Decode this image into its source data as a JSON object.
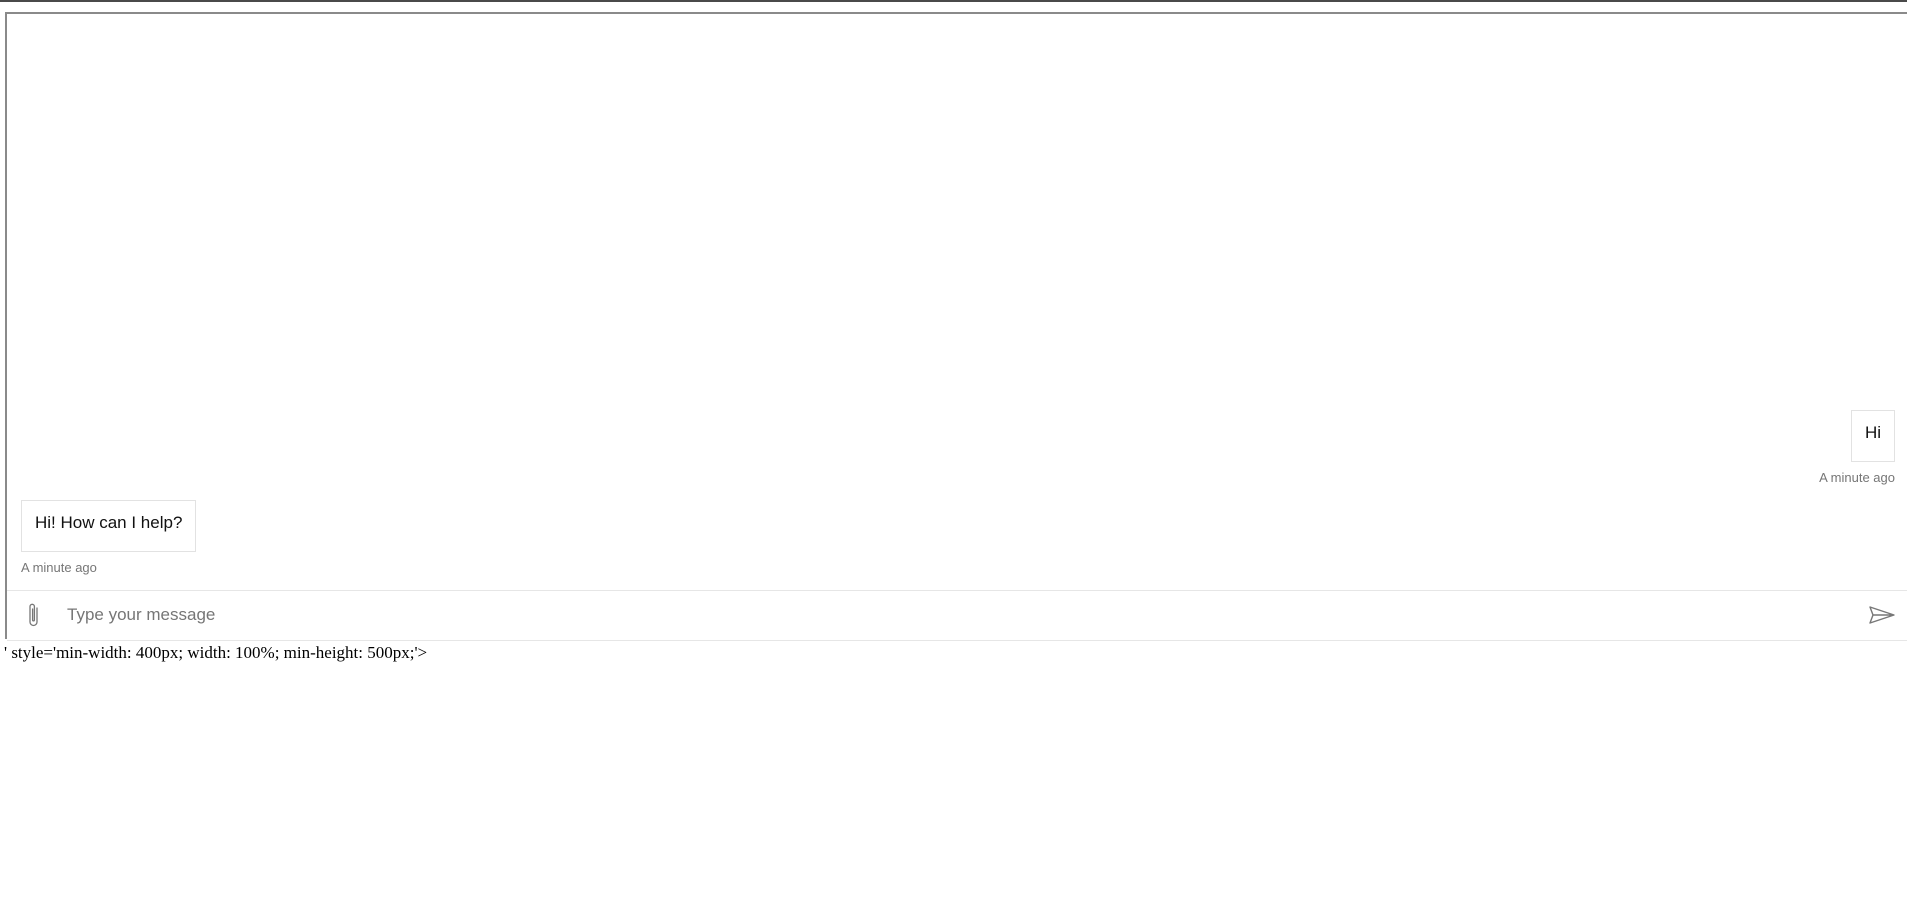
{
  "messages": [
    {
      "sender": "user",
      "text": "Hi",
      "timestamp": "A minute ago"
    },
    {
      "sender": "bot",
      "text": "Hi! How can I help?",
      "timestamp": "A minute ago"
    }
  ],
  "composer": {
    "placeholder": "Type your message",
    "value": "",
    "attach_icon": "paperclip-icon",
    "send_icon": "send-icon"
  },
  "page_text": {
    "leaked_markup": "' style='min-width: 400px; width: 100%; min-height: 500px;'>"
  },
  "colors": {
    "frame_border": "#8a8a8a",
    "bubble_border": "#e2e2e2",
    "muted_text": "#767676",
    "icon": "#777777"
  }
}
